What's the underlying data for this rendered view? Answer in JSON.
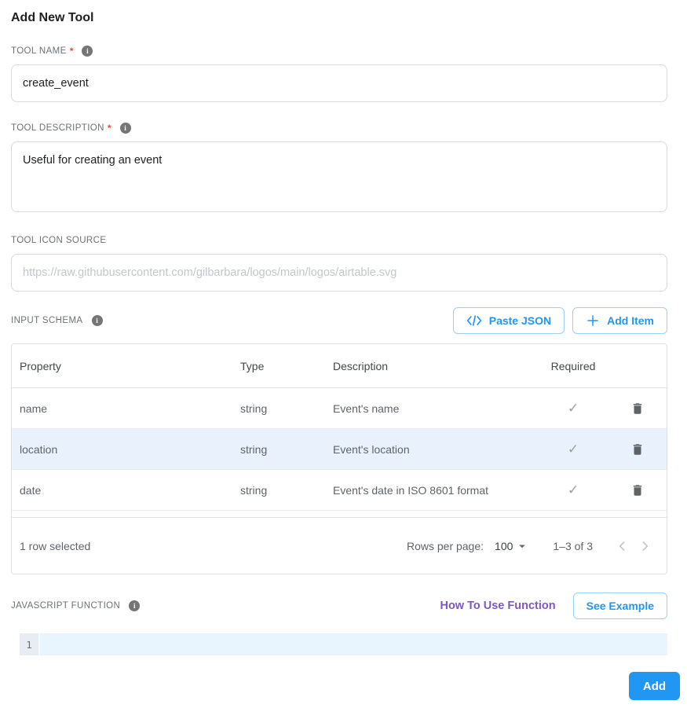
{
  "page": {
    "title": "Add New Tool"
  },
  "fields": {
    "tool_name": {
      "label": "TOOL NAME",
      "required_mark": "*",
      "value": "create_event"
    },
    "tool_description": {
      "label": "TOOL DESCRIPTION",
      "required_mark": "*",
      "value": "Useful for creating an event"
    },
    "tool_icon_source": {
      "label": "TOOL ICON SOURCE",
      "value": "",
      "placeholder": "https://raw.githubusercontent.com/gilbarbara/logos/main/logos/airtable.svg"
    }
  },
  "input_schema": {
    "label": "INPUT SCHEMA",
    "paste_json_label": "Paste JSON",
    "add_item_label": "Add Item",
    "table": {
      "columns": [
        "Property",
        "Type",
        "Description",
        "Required"
      ],
      "rows": [
        {
          "property": "name",
          "type": "string",
          "description": "Event's name",
          "required": true
        },
        {
          "property": "location",
          "type": "string",
          "description": "Event's location",
          "required": true,
          "selected": true
        },
        {
          "property": "date",
          "type": "string",
          "description": "Event's date in ISO 8601 format",
          "required": true
        }
      ],
      "footer": {
        "selected_text": "1 row selected",
        "rows_per_page_label": "Rows per page:",
        "rows_per_page_value": "100",
        "range_text": "1–3 of 3"
      }
    }
  },
  "javascript_function": {
    "label": "JAVASCRIPT FUNCTION",
    "how_to_link": "How To Use Function",
    "see_example_label": "See Example",
    "editor": {
      "line_number": "1",
      "content": ""
    }
  },
  "actions": {
    "add_label": "Add"
  },
  "icons": {
    "info": "i",
    "check": "✓"
  },
  "colors": {
    "accent_blue": "#2196f3",
    "outline_blue": "#9ecff5",
    "link_purple": "#7e57c2",
    "required_red": "#f44336",
    "selected_row": "#e9f2fc",
    "editor_line": "#e9f5fe"
  }
}
